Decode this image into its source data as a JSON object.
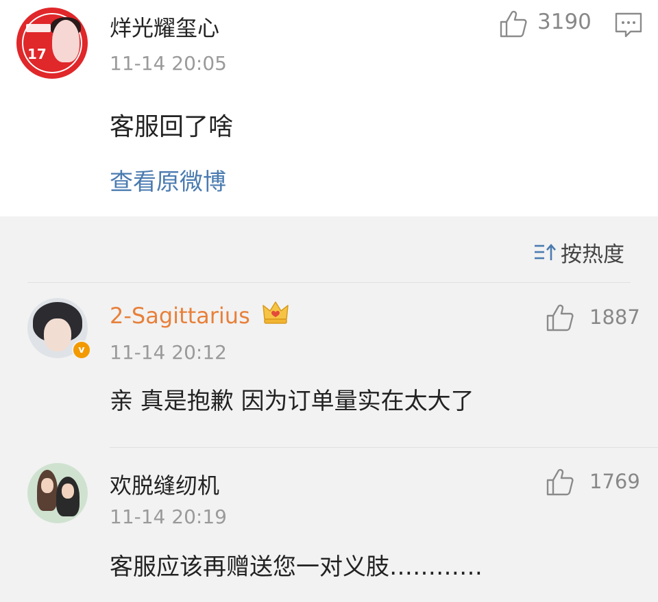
{
  "post": {
    "username": "烊光耀玺心",
    "timestamp": "11-14 20:05",
    "content": "客服回了啥",
    "link": "查看原微博",
    "like_count": "3190",
    "avatar_text": "17"
  },
  "sort": {
    "label": "按热度"
  },
  "comments": [
    {
      "username": "2-Sagittarius",
      "timestamp": "11-14 20:12",
      "content": "亲 真是抱歉 因为订单量实在太大了",
      "like_count": "1887",
      "verified_badge": "v"
    },
    {
      "username": "欢脱缝纫机",
      "timestamp": "11-14 20:19",
      "content": "客服应该再赠送您一对义肢…………",
      "like_count": "1769"
    }
  ],
  "colors": {
    "link": "#4a7bb0",
    "vip_name": "#e8803a",
    "avatar_red": "#e0272a",
    "background": "#f2f2f2"
  }
}
